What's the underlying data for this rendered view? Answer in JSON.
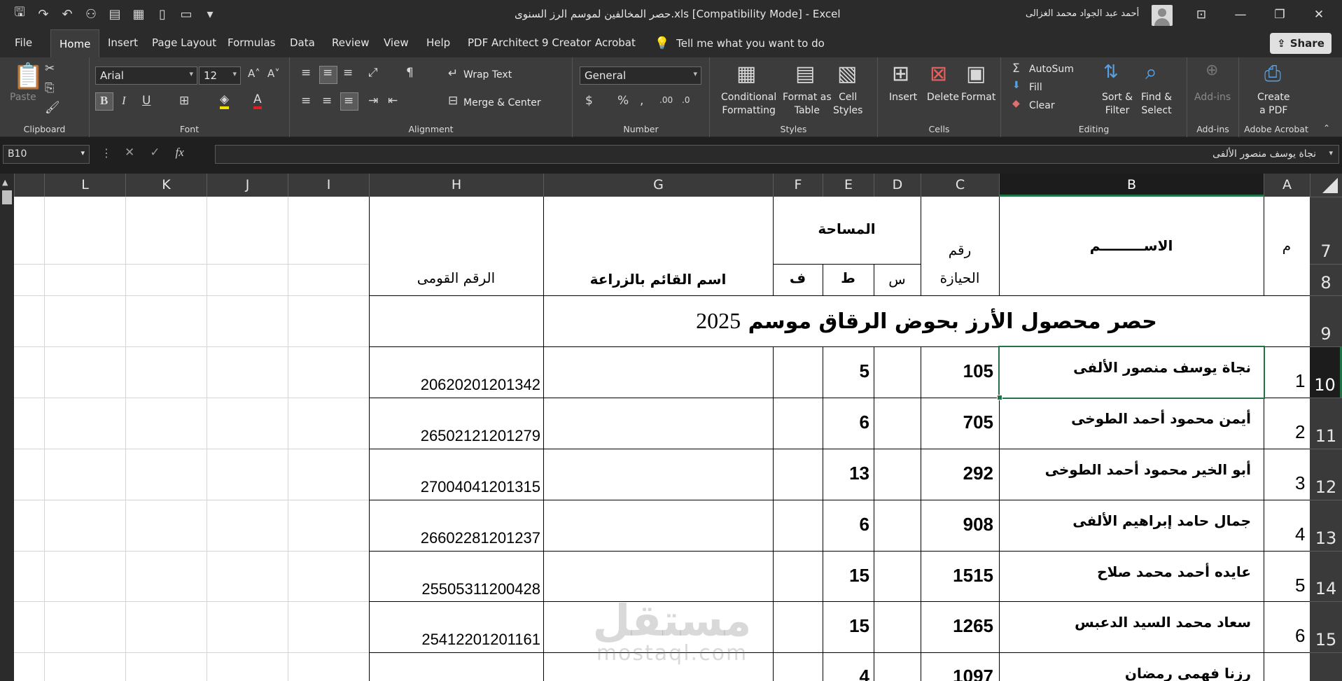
{
  "window": {
    "title": "حصر المخالفين لموسم الرز السنوى.xls  [Compatibility Mode]  -  Excel",
    "user": "أحمد عبد الجواد محمد الغزالى"
  },
  "menu": {
    "file": "File",
    "home": "Home",
    "insert": "Insert",
    "page_layout": "Page Layout",
    "formulas": "Formulas",
    "data": "Data",
    "review": "Review",
    "view": "View",
    "help": "Help",
    "pdf_architect": "PDF Architect 9 Creator",
    "acrobat": "Acrobat",
    "tell_me": "Tell me what you want to do",
    "share": "Share"
  },
  "ribbon": {
    "clipboard": {
      "label": "Clipboard",
      "paste": "Paste"
    },
    "font": {
      "label": "Font",
      "name": "Arial",
      "size": "12"
    },
    "alignment": {
      "label": "Alignment",
      "wrap_text": "Wrap Text",
      "merge_center": "Merge & Center"
    },
    "number": {
      "label": "Number",
      "format": "General"
    },
    "styles": {
      "label": "Styles",
      "conditional_1": "Conditional",
      "conditional_2": "Formatting",
      "format_table_1": "Format as",
      "format_table_2": "Table",
      "cell_styles_1": "Cell",
      "cell_styles_2": "Styles"
    },
    "cells": {
      "label": "Cells",
      "insert": "Insert",
      "delete": "Delete",
      "format": "Format"
    },
    "editing": {
      "label": "Editing",
      "autosum": "AutoSum",
      "fill": "Fill",
      "clear": "Clear",
      "sort_1": "Sort &",
      "sort_2": "Filter",
      "find_1": "Find &",
      "find_2": "Select"
    },
    "addins": {
      "label": "Add-ins",
      "button": "Add-ins"
    },
    "acrobat": {
      "label": "Adobe Acrobat",
      "create_1": "Create",
      "create_2": "a PDF"
    }
  },
  "formula_bar": {
    "name_box": "B10",
    "content": "نجاة يوسف منصور الألفى"
  },
  "columns": [
    "L",
    "K",
    "J",
    "I",
    "H",
    "G",
    "F",
    "E",
    "D",
    "C",
    "B",
    "A"
  ],
  "row_numbers": [
    "7",
    "8",
    "9",
    "10",
    "11",
    "12",
    "13",
    "14",
    "15"
  ],
  "header": {
    "m": "م",
    "name": "الاســـــــــم",
    "holding_1": "رقم",
    "holding_2": "الحيازة",
    "area": "المساحة",
    "s": "س",
    "t": "ط",
    "f": "ف",
    "agri_name": "اسم القائم بالزراعة",
    "national_id": "الرقم القومى"
  },
  "banner": {
    "text": "حصر محصول الأرز بحوض الرقاق موسم",
    "year": "2025"
  },
  "rows": [
    {
      "m": "1",
      "name": "نجاة يوسف منصور الألفى",
      "holding": "105",
      "t": "5",
      "national_id": "20620201201342"
    },
    {
      "m": "2",
      "name": "أيمن محمود أحمد الطوخى",
      "holding": "705",
      "t": "6",
      "national_id": "26502121201279"
    },
    {
      "m": "3",
      "name": "أبو الخير محمود أحمد الطوخى",
      "holding": "292",
      "t": "13",
      "national_id": "27004041201315"
    },
    {
      "m": "4",
      "name": "جمال حامد إبراهيم الألفى",
      "holding": "908",
      "t": "6",
      "national_id": "26602281201237"
    },
    {
      "m": "5",
      "name": "عايده أحمد محمد صلاح",
      "holding": "1515",
      "t": "15",
      "national_id": "25505311200428"
    },
    {
      "m": "6",
      "name": "سعاد محمد السيد الدعبس",
      "holding": "1265",
      "t": "15",
      "national_id": "25412201201161"
    },
    {
      "m": "",
      "name": "رزنا فهمى رمضان",
      "holding": "1097",
      "t": "4",
      "national_id": ""
    }
  ],
  "watermark": {
    "arabic": "مستقل",
    "latin": "mostaql.com"
  }
}
